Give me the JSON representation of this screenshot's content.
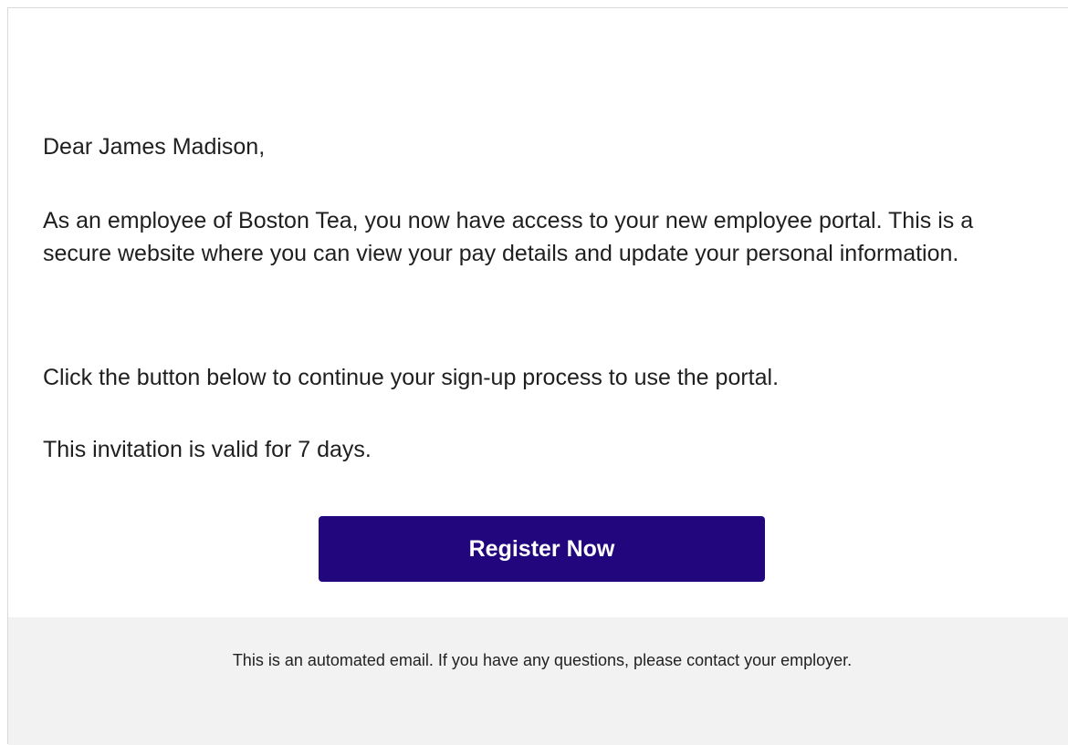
{
  "email": {
    "greeting": "Dear James Madison,",
    "paragraphs": {
      "intro": "As an employee of Boston Tea, you now have access to your new employee portal. This is a secure website where you can view your pay details and update your personal information.",
      "instructions": "Click the button below to continue your sign-up process to use the portal.",
      "validity": "This invitation is valid for 7 days."
    },
    "cta": {
      "label": "Register Now"
    },
    "footer": {
      "text": "This is an automated email. If you have any questions, please contact your employer."
    }
  },
  "colors": {
    "button_background": "#22067d",
    "button_text": "#ffffff",
    "footer_background": "#f2f2f2",
    "body_text": "#1f1f1f"
  }
}
